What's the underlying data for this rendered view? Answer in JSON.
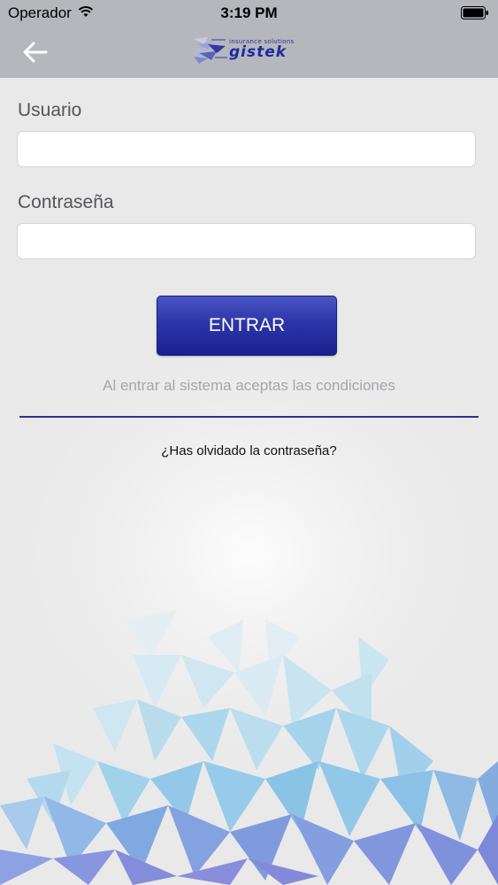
{
  "status_bar": {
    "carrier": "Operador",
    "time": "3:19 PM",
    "wifi_icon": "wifi-icon",
    "battery_icon": "battery-icon"
  },
  "nav_bar": {
    "back_icon": "arrow-left-icon",
    "logo": {
      "tagline": "insurance solutions",
      "wordmark": "gistek",
      "color": "#1c2aa0"
    }
  },
  "form": {
    "username_label": "Usuario",
    "username_value": "",
    "password_label": "Contraseña",
    "password_value": "",
    "submit_label": "ENTRAR",
    "terms_text": "Al entrar al sistema aceptas las condiciones",
    "forgot_password": "¿Has olvidado la contraseña?"
  },
  "colors": {
    "nav_background": "#b6b7bc",
    "page_background": "#e9e9ea",
    "button_primary": "#2c35a8",
    "divider": "#2a3290"
  }
}
